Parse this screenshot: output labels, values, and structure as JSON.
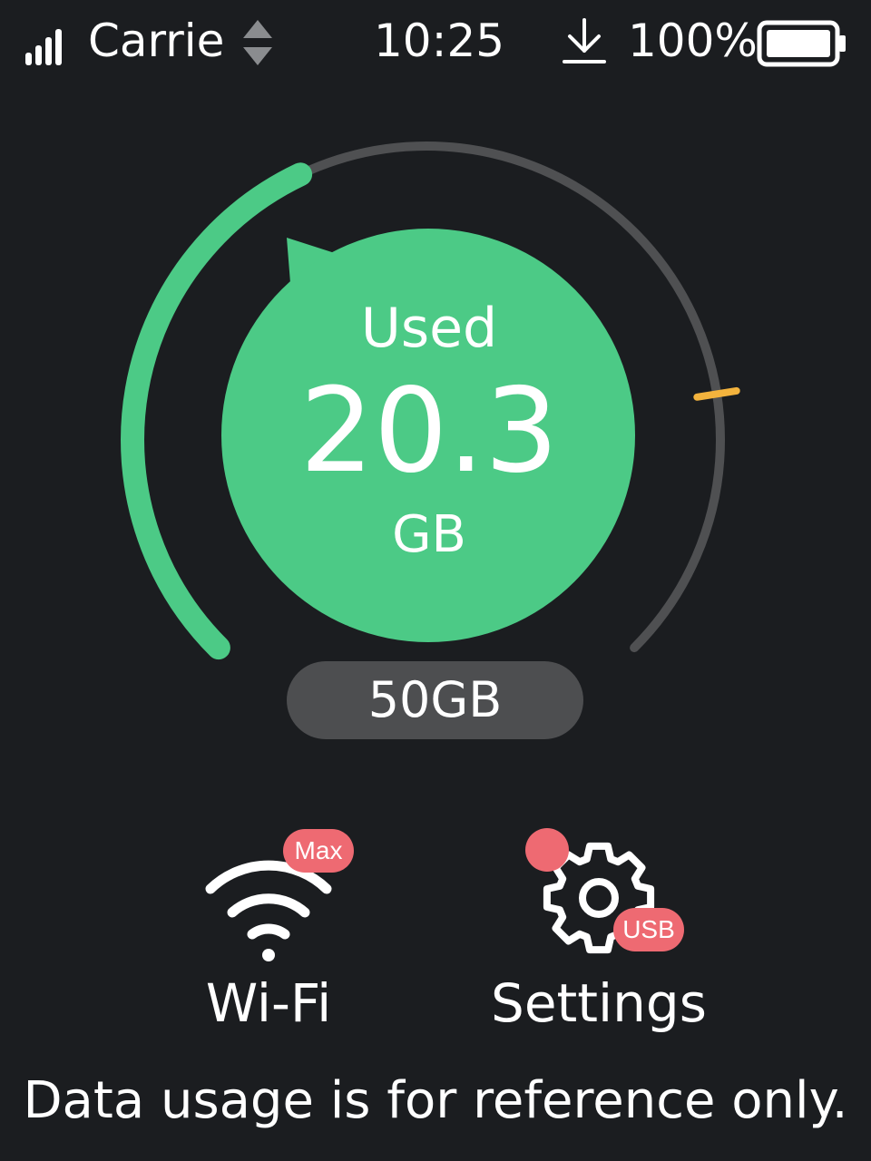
{
  "status_bar": {
    "signal_icon": "signal-strength-icon",
    "signal_level": 4,
    "carrier": "Carrie",
    "switch_icon": "switch-arrows-icon",
    "time": "10:25",
    "download_icon": "download-icon",
    "battery_percent": "100%",
    "battery_icon": "battery-icon",
    "battery_level": 1.0
  },
  "usage": {
    "used_label": "Used",
    "used_value": "20.3",
    "used_unit": "GB",
    "quota": "50GB",
    "used_fraction": 0.406,
    "warning_fraction": 0.8,
    "colors": {
      "used": "#4cca86",
      "track": "#4f5052",
      "warning": "#f3b33d",
      "background": "#1b1d20"
    }
  },
  "actions": {
    "wifi": {
      "label": "Wi-Fi",
      "badge": "Max",
      "icon": "wifi-icon"
    },
    "settings": {
      "label": "Settings",
      "badge": "USB",
      "icon": "gear-icon",
      "has_notification": true
    }
  },
  "footer": {
    "disclaimer": "Data usage is for reference only."
  },
  "colors": {
    "badge": "#ee6a72",
    "pill": "#4d4e50",
    "text": "#ffffff"
  }
}
